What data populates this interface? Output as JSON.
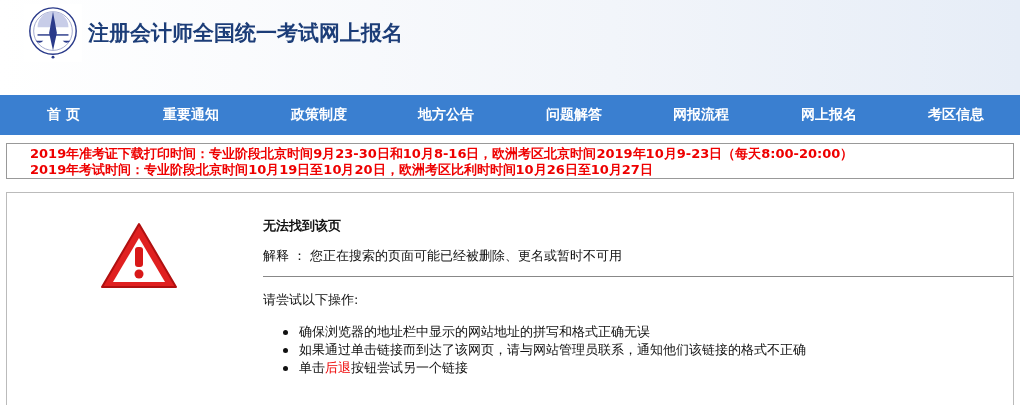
{
  "header": {
    "title": "注册会计师全国统一考试网上报名"
  },
  "nav": [
    {
      "label": "首 页"
    },
    {
      "label": "重要通知"
    },
    {
      "label": "政策制度"
    },
    {
      "label": "地方公告"
    },
    {
      "label": "问题解答"
    },
    {
      "label": "网报流程"
    },
    {
      "label": "网上报名"
    },
    {
      "label": "考区信息"
    }
  ],
  "notices": [
    "2019年准考证下载打印时间：专业阶段北京时间9月23-30日和10月8-16日，欧洲考区北京时间2019年10月9-23日（每天8:00-20:00）",
    "2019年考试时间：专业阶段北京时间10月19日至10月20日，欧洲考区比利时时间10月26日至10月27日"
  ],
  "error": {
    "title": "无法找到该页",
    "explanation": "解释 ： 您正在搜索的页面可能已经被删除、更名或暂时不可用",
    "prompt": "请尝试以下操作:",
    "steps": [
      {
        "kind": "text",
        "text": "确保浏览器的地址栏中显示的网站地址的拼写和格式正确无误"
      },
      {
        "kind": "text",
        "text": "如果通过单击链接而到达了该网页，请与网站管理员联系，通知他们该链接的格式不正确"
      },
      {
        "kind": "link",
        "before": "单击",
        "link": "后退",
        "after": "按钮尝试另一个链接"
      }
    ]
  }
}
